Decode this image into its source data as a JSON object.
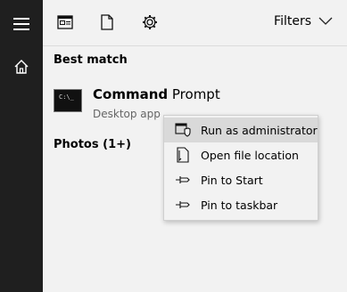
{
  "rail": {
    "items": [
      {
        "icon": "hamburger-menu-icon"
      },
      {
        "icon": "home-icon"
      }
    ]
  },
  "topbar": {
    "icons": [
      "documents-icon",
      "file-icon",
      "settings-gear-icon"
    ],
    "filters_label": "Filters",
    "filters_icon": "chevron-down-icon"
  },
  "best_match": {
    "heading": "Best match",
    "app_name_bold": "Command",
    "app_name_rest": " Prompt",
    "app_type": "Desktop app",
    "icon": "command-prompt-icon",
    "icon_text": "C:\\_"
  },
  "photos": {
    "heading": "Photos (1+)"
  },
  "context_menu": {
    "items": [
      {
        "label": "Run as administrator",
        "icon": "shield-admin-icon",
        "highlighted": true
      },
      {
        "label": "Open file location",
        "icon": "folder-location-icon",
        "highlighted": false
      },
      {
        "label": "Pin to Start",
        "icon": "pin-icon",
        "highlighted": false
      },
      {
        "label": "Pin to taskbar",
        "icon": "pin-icon",
        "highlighted": false
      }
    ]
  },
  "colors": {
    "rail": "#1f1f1f",
    "panel": "#f2f2f2",
    "menu_highlight": "#d9d9d9"
  }
}
